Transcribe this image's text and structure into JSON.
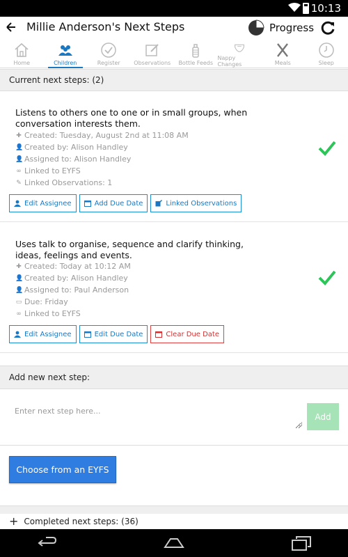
{
  "status_bar": {
    "time": "10:13"
  },
  "app_bar": {
    "title": "Millie Anderson's Next Steps",
    "progress_label": "Progress"
  },
  "tabs": [
    {
      "label": "Home",
      "icon": "home-icon"
    },
    {
      "label": "Children",
      "icon": "children-icon"
    },
    {
      "label": "Register",
      "icon": "register-check-icon"
    },
    {
      "label": "Observations",
      "icon": "observations-edit-icon"
    },
    {
      "label": "Bottle Feeds",
      "icon": "bottle-icon"
    },
    {
      "label": "Nappy Changes",
      "icon": "nappy-icon"
    },
    {
      "label": "Meals",
      "icon": "meals-icon"
    },
    {
      "label": "Sleep",
      "icon": "sleep-clock-icon"
    }
  ],
  "current_header": "Current next steps: (2)",
  "steps": [
    {
      "description": "Listens to others one to one or in small groups, when conversation interests them.",
      "created": "Created: Tuesday, August 2nd at 11:08 AM",
      "created_by": "Created by: Alison Handley",
      "assigned_to": "Assigned to: Alison Handley",
      "linked": "Linked to EYFS",
      "linked_observations": "Linked Observations: 1",
      "buttons": [
        "Edit Assignee",
        "Add Due Date",
        "Linked Observations"
      ]
    },
    {
      "description": "Uses talk to organise, sequence and clarify thinking, ideas, feelings and events.",
      "created": "Created: Today at 10:12 AM",
      "created_by": "Created by: Alison Handley",
      "assigned_to": "Assigned to: Paul Anderson",
      "due": "Due: Friday",
      "linked": "Linked to EYFS",
      "buttons": [
        "Edit Assignee",
        "Edit Due Date",
        "Clear Due Date"
      ]
    }
  ],
  "add_header": "Add new next step:",
  "input": {
    "placeholder": "Enter next step here..."
  },
  "add_button": "Add",
  "eyfs_button": "Choose from an EYFS",
  "completed": {
    "plus": "+",
    "label": "Completed next steps: (36)"
  },
  "colors": {
    "accent": "#1a78c2",
    "check": "#2ec45a",
    "danger": "#d03030",
    "add_disabled": "#a6e3b6",
    "primary_button": "#2f7de0"
  }
}
